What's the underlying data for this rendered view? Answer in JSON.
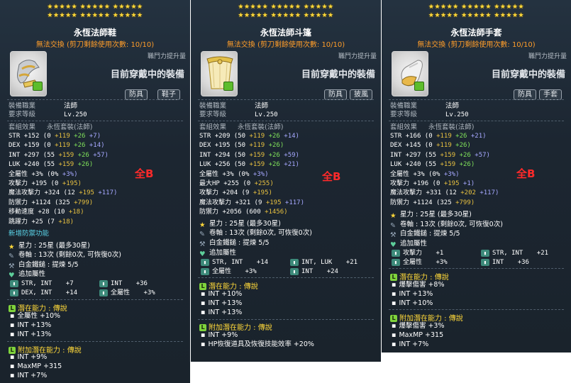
{
  "panels": [
    {
      "id": "shoes",
      "title": "永恆法師鞋",
      "untrade": "無法交換 (剪刀剩餘使用次數: 10/10)",
      "combat_label": "職鬥力提升量",
      "wearing": "目前穿戴中的裝備",
      "tags": [
        "防具",
        "鞋子"
      ],
      "job_label": "裝備職業",
      "job_value": "法師",
      "req_label": "要求等級",
      "req_value": "Lv.250",
      "set_label": "套組效果",
      "set_value": "永恆套裝(法師)",
      "all_b": "全B",
      "stats": [
        {
          "name": "STR",
          "total": "+152",
          "base": "(0",
          "a": "+119",
          "b": "+26",
          "c": "+7)"
        },
        {
          "name": "DEX",
          "total": "+159",
          "base": "(0",
          "a": "+119",
          "b": "+26",
          "c": "+14)"
        },
        {
          "name": "INT",
          "total": "+297",
          "base": "(55",
          "a": "+159",
          "b": "+26",
          "c": "+57)"
        },
        {
          "name": "LUK",
          "total": "+240",
          "base": "(55",
          "a": "+159",
          "b": "+26)",
          "c": ""
        },
        {
          "name": "全屬性",
          "total": "+3%",
          "base": "(0%",
          "a": "",
          "b": "",
          "c": "+3%)"
        },
        {
          "name": "攻擊力",
          "total": "+195",
          "base": "(0",
          "a": "+195)",
          "b": "",
          "c": ""
        },
        {
          "name": "魔法攻擊力",
          "total": "+324",
          "base": "(12",
          "a": "+195",
          "b": "",
          "c": "+117)"
        },
        {
          "name": "防禦力",
          "total": "+1124",
          "base": "(325",
          "a": "+799)",
          "b": "",
          "c": ""
        },
        {
          "name": "移動速度",
          "total": "+28",
          "base": "(10",
          "a": "+18)",
          "b": "",
          "c": ""
        },
        {
          "name": "跳躍力",
          "total": "+25",
          "base": "(7",
          "a": "+18)",
          "b": "",
          "c": ""
        }
      ],
      "new_func": "新增防禦功能",
      "star_label": "星力",
      "star_value": ": 25星 (最多30星)",
      "scroll_label": "卷軸",
      "scroll_value": ": 13次 (剩餘0次, 可恢復0次)",
      "hammer_label": "白金鐵鎚",
      "hammer_value": ": 提煉 5/5",
      "extra_label": "追加屬性",
      "extra": [
        [
          "STR, INT",
          "+7",
          "INT",
          "+36"
        ],
        [
          "DEX, INT",
          "+14",
          "全屬性",
          "+3%"
        ]
      ],
      "pot_label": "潛在能力 : 傳說",
      "pot": [
        "全屬性 +10%",
        "INT +13%",
        "INT +13%"
      ],
      "addpot_label": "附加潛在能力 : 傳說",
      "addpot": [
        "INT +9%",
        "MaxMP +315",
        "INT +7%"
      ]
    },
    {
      "id": "cape",
      "title": "永恆法師斗篷",
      "untrade": "無法交換 (剪刀剩餘使用次數: 10/10)",
      "combat_label": "職鬥力提升量",
      "wearing": "目前穿戴中的裝備",
      "tags": [
        "防具",
        "披風"
      ],
      "job_label": "裝備職業",
      "job_value": "法師",
      "req_label": "要求等級",
      "req_value": "Lv.250",
      "set_label": "套組效果",
      "set_value": "永恆套裝(法師)",
      "all_b": "全B",
      "stats": [
        {
          "name": "STR",
          "total": "+209",
          "base": "(50",
          "a": "+119",
          "b": "+26",
          "c": "+14)"
        },
        {
          "name": "DEX",
          "total": "+195",
          "base": "(50",
          "a": "+119",
          "b": "+26)",
          "c": ""
        },
        {
          "name": "INT",
          "total": "+294",
          "base": "(50",
          "a": "+159",
          "b": "+26",
          "c": "+59)"
        },
        {
          "name": "LUK",
          "total": "+256",
          "base": "(50",
          "a": "+159",
          "b": "+26",
          "c": "+21)"
        },
        {
          "name": "全屬性",
          "total": "+3%",
          "base": "(0%",
          "a": "",
          "b": "",
          "c": "+3%)"
        },
        {
          "name": "最大HP",
          "total": "+255",
          "base": "(0",
          "a": "+255)",
          "b": "",
          "c": ""
        },
        {
          "name": "攻擊力",
          "total": "+204",
          "base": "(9",
          "a": "+195)",
          "b": "",
          "c": ""
        },
        {
          "name": "魔法攻擊力",
          "total": "+321",
          "base": "(9",
          "a": "+195",
          "b": "",
          "c": "+117)"
        },
        {
          "name": "防禦力",
          "total": "+2056",
          "base": "(600",
          "a": "+1456)",
          "b": "",
          "c": ""
        }
      ],
      "star_label": "星力",
      "star_value": ": 25星 (最多30星)",
      "scroll_label": "卷軸",
      "scroll_value": ": 13次 (剩餘0次, 可恢復0次)",
      "hammer_label": "白金鐵鎚",
      "hammer_value": ": 提煉 5/5",
      "extra_label": "追加屬性",
      "extra": [
        [
          "STR, INT",
          "+14",
          "INT, LUK",
          "+21"
        ],
        [
          "全屬性",
          "+3%",
          "INT",
          "+24"
        ]
      ],
      "pot_label": "潛在能力 : 傳說",
      "pot": [
        "INT +10%",
        "INT +13%",
        "INT +13%"
      ],
      "addpot_label": "附加潛在能力 : 傳說",
      "addpot": [
        "INT +9%",
        "HP恢復道具及恢復技能效率 +20%"
      ]
    },
    {
      "id": "gloves",
      "title": "永恆法師手套",
      "untrade": "無法交換 (剪刀剩餘使用次數: 10/10)",
      "combat_label": "職鬥力提升量",
      "wearing": "目前穿戴中的裝備",
      "tags": [
        "防具",
        "手套"
      ],
      "job_label": "裝備職業",
      "job_value": "法師",
      "req_label": "要求等級",
      "req_value": "Lv.250",
      "set_label": "套組效果",
      "set_value": "永恆套裝(法師)",
      "all_b": "全B",
      "stats": [
        {
          "name": "STR",
          "total": "+166",
          "base": "(0",
          "a": "+119",
          "b": "+26",
          "c": "+21)"
        },
        {
          "name": "DEX",
          "total": "+145",
          "base": "(0",
          "a": "+119",
          "b": "+26)",
          "c": ""
        },
        {
          "name": "INT",
          "total": "+297",
          "base": "(55",
          "a": "+159",
          "b": "+26",
          "c": "+57)"
        },
        {
          "name": "LUK",
          "total": "+240",
          "base": "(55",
          "a": "+159",
          "b": "+26)",
          "c": ""
        },
        {
          "name": "全屬性",
          "total": "+3%",
          "base": "(0%",
          "a": "",
          "b": "",
          "c": "+3%)"
        },
        {
          "name": "攻擊力",
          "total": "+196",
          "base": "(0",
          "a": "+195",
          "b": "",
          "c": "+1)"
        },
        {
          "name": "魔法攻擊力",
          "total": "+331",
          "base": "(12",
          "a": "+202",
          "b": "",
          "c": "+117)"
        },
        {
          "name": "防禦力",
          "total": "+1124",
          "base": "(325",
          "a": "+799)",
          "b": "",
          "c": ""
        }
      ],
      "star_label": "星力",
      "star_value": ": 25星 (最多30星)",
      "scroll_label": "卷軸",
      "scroll_value": ": 13次 (剩餘0次, 可恢復0次)",
      "hammer_label": "白金鐵鎚",
      "hammer_value": ": 提煉 5/5",
      "extra_label": "追加屬性",
      "extra": [
        [
          "攻擊力",
          "+1",
          "STR, INT",
          "+21"
        ],
        [
          "全屬性",
          "+3%",
          "INT",
          "+36"
        ]
      ],
      "pot_label": "潛在能力 : 傳說",
      "pot": [
        "爆擊傷害 +8%",
        "INT +13%",
        "INT +10%"
      ],
      "addpot_label": "附加潛在能力 : 傳說",
      "addpot": [
        "爆擊傷害 +3%",
        "MaxMP +315",
        "INT +7%"
      ]
    }
  ],
  "colors": {
    "base": "#ffffff",
    "star_force": "#e8c140",
    "scroll": "#7fe05a",
    "addopt": "#a6a8ff",
    "potential": "#ffd93a",
    "allb": "#ff2a2a"
  }
}
